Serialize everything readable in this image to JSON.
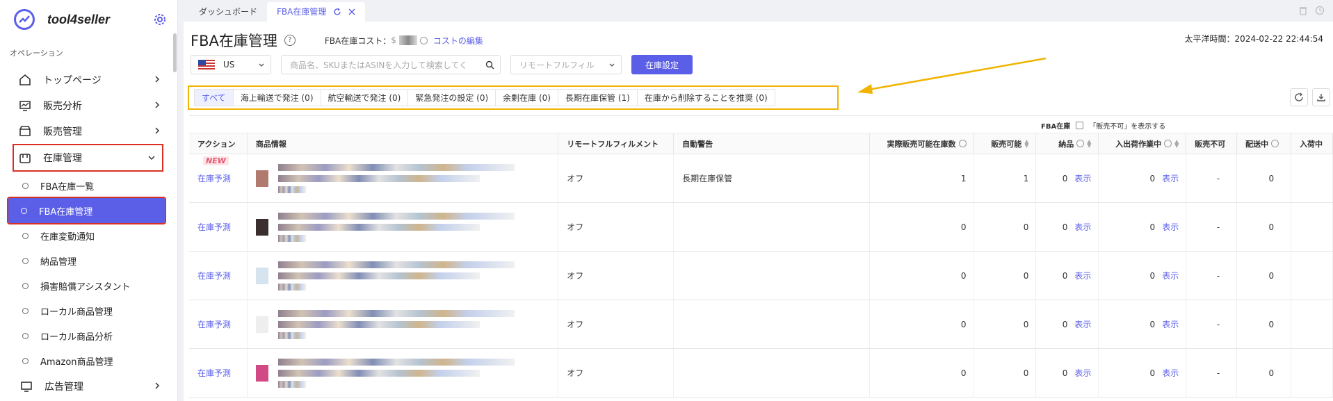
{
  "sidebar": {
    "app_name": "tool4seller",
    "section_label": "オペレーション",
    "items": [
      {
        "label": "トップページ",
        "icon": "home-icon"
      },
      {
        "label": "販売分析",
        "icon": "chart-monitor-icon"
      },
      {
        "label": "販売管理",
        "icon": "store-icon"
      },
      {
        "label": "在庫管理",
        "icon": "inventory-box-icon"
      }
    ],
    "sub_items": [
      {
        "label": "FBA在庫一覧"
      },
      {
        "label": "FBA在庫管理"
      },
      {
        "label": "在庫変動通知"
      },
      {
        "label": "納品管理"
      },
      {
        "label": "損害賠償アシスタント"
      },
      {
        "label": "ローカル商品管理"
      },
      {
        "label": "ローカル商品分析"
      },
      {
        "label": "Amazon商品管理"
      }
    ],
    "bottom_item": {
      "label": "広告管理",
      "icon": "monitor-icon"
    }
  },
  "tabs": [
    {
      "label": "ダッシュボード"
    },
    {
      "label": "FBA在庫管理"
    }
  ],
  "header": {
    "title": "FBA在庫管理",
    "help": "?",
    "cost_label": "FBA在庫コスト：",
    "cost_value_prefix": "$",
    "cost_link": "コストの編集",
    "timezone": "太平洋時間：2024-02-22 22:44:54"
  },
  "filters": {
    "country": "US",
    "search_placeholder": "商品名、SKUまたはASINを入力して検索してく",
    "remote_placeholder": "リモートフルフィル",
    "settings_button": "在庫設定"
  },
  "filter_tabs": [
    "すべて",
    "海上輸送で発注 (0)",
    "航空輸送で発注 (0)",
    "緊急発注の設定 (0)",
    "余剰在庫 (0)",
    "長期在庫保管 (1)",
    "在庫から削除することを推奨 (0)"
  ],
  "table": {
    "group_label": "FBA在庫",
    "group_checkbox_label": "「販売不可」を表示する",
    "columns": [
      "アクション",
      "商品情報",
      "リモートフルフィルメント",
      "自動警告",
      "実際販売可能在庫数",
      "販売可能",
      "納品",
      "入出荷作業中",
      "販売不可",
      "配送中",
      "入荷中"
    ],
    "badge": "NEW",
    "rows": [
      {
        "action": "在庫予測",
        "remote": "オフ",
        "warning": "長期在庫保管",
        "actual": "1",
        "sellable": "1",
        "inbound": "0",
        "inbound_link": "表示",
        "working": "0",
        "working_link": "表示",
        "unsellable": "-",
        "shipping": "0",
        "thumb": "#b07a6e"
      },
      {
        "action": "在庫予測",
        "remote": "オフ",
        "warning": "",
        "actual": "0",
        "sellable": "0",
        "inbound": "0",
        "inbound_link": "表示",
        "working": "0",
        "working_link": "表示",
        "unsellable": "-",
        "shipping": "0",
        "thumb": "#3a2e2e"
      },
      {
        "action": "在庫予測",
        "remote": "オフ",
        "warning": "",
        "actual": "0",
        "sellable": "0",
        "inbound": "0",
        "inbound_link": "表示",
        "working": "0",
        "working_link": "表示",
        "unsellable": "-",
        "shipping": "0",
        "thumb": "#d6e4f0"
      },
      {
        "action": "在庫予測",
        "remote": "オフ",
        "warning": "",
        "actual": "0",
        "sellable": "0",
        "inbound": "0",
        "inbound_link": "表示",
        "working": "0",
        "working_link": "表示",
        "unsellable": "-",
        "shipping": "0",
        "thumb": "#eeeeee"
      },
      {
        "action": "在庫予測",
        "remote": "オフ",
        "warning": "",
        "actual": "0",
        "sellable": "0",
        "inbound": "0",
        "inbound_link": "表示",
        "working": "0",
        "working_link": "表示",
        "unsellable": "-",
        "shipping": "0",
        "thumb": "#d14a86"
      }
    ]
  },
  "colors": {
    "accent": "#5b5fe8",
    "highlight_red": "#d93025",
    "highlight_yellow": "#f0b400"
  }
}
